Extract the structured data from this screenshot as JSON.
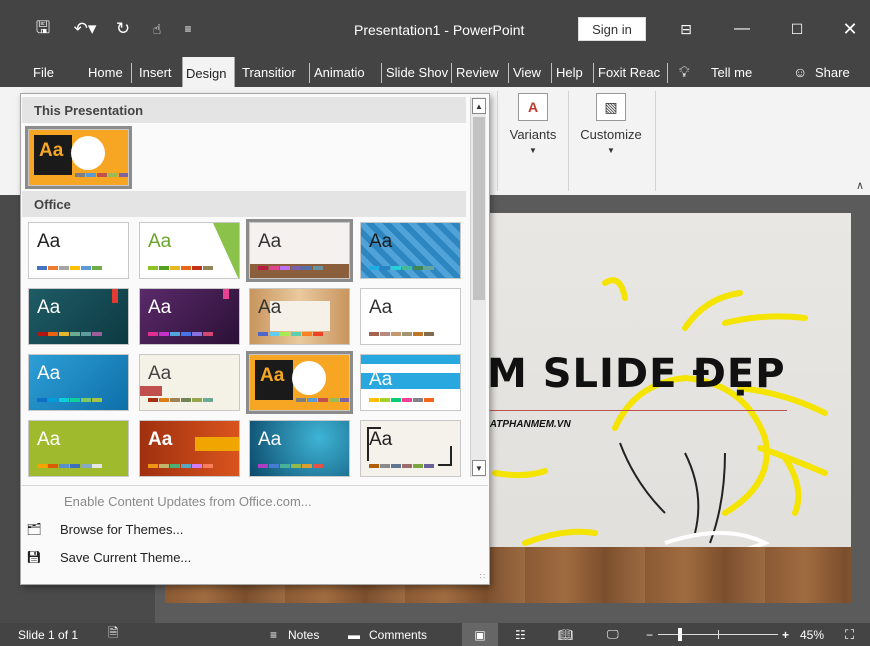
{
  "titlebar": {
    "title": "Presentation1  -  PowerPoint",
    "sign_in": "Sign in",
    "qa_icons": [
      "save-icon",
      "undo-icon",
      "redo-icon",
      "touch-mode-icon",
      "customize-qat-icon"
    ]
  },
  "tabs": [
    {
      "label": "File"
    },
    {
      "label": "Home"
    },
    {
      "label": "Insert"
    },
    {
      "label": "Design"
    },
    {
      "label": "Transitior"
    },
    {
      "label": "Animatio"
    },
    {
      "label": "Slide Shov"
    },
    {
      "label": "Review"
    },
    {
      "label": "View"
    },
    {
      "label": "Help"
    },
    {
      "label": "Foxit Reac"
    }
  ],
  "tell_me": "Tell me",
  "share": "Share",
  "ribbon": {
    "variants": "Variants",
    "customize": "Customize"
  },
  "dropdown": {
    "section_this": "This Presentation",
    "section_office": "Office",
    "themes_aa": "Aa",
    "enable_updates": "Enable Content Updates from Office.com...",
    "browse": "Browse for Themes...",
    "save": "Save Current Theme..."
  },
  "slide": {
    "title": "M SLIDE ĐẸP",
    "subtitle": "IATPHANMEM.VN"
  },
  "statusbar": {
    "slide_info": "Slide 1 of 1",
    "notes": "Notes",
    "comments": "Comments",
    "zoom": "45%"
  },
  "colors": {
    "chrome": "#444444",
    "ribbon": "#f3f3f3",
    "accent_orange": "#f6a623",
    "selection_border": "#8c8c8c"
  }
}
